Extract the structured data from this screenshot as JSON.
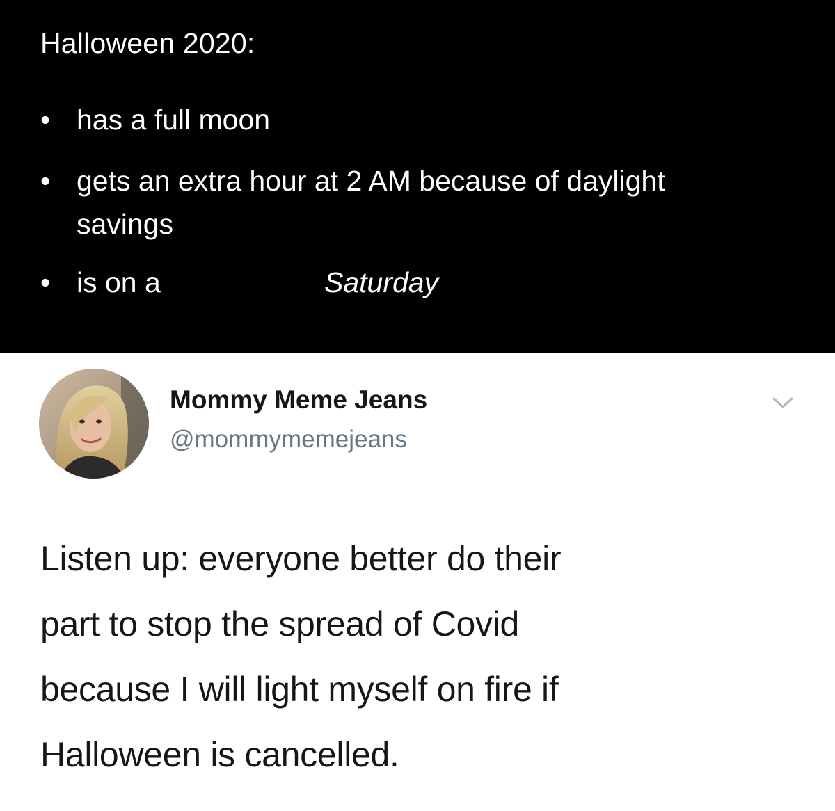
{
  "top_panel": {
    "title": "Halloween 2020:",
    "bullet_symbol": "•",
    "bullets": [
      {
        "text": "has a full moon"
      },
      {
        "text": "gets an extra hour at 2 AM because of daylight",
        "continuation": "savings"
      },
      {
        "text": "is on a",
        "emphasis": "Saturday"
      }
    ],
    "background_color": "#000000",
    "text_color": "#ffffff"
  },
  "tweet": {
    "display_name": "Mommy Meme Jeans",
    "handle": "@mommymemejeans",
    "avatar_icon": "profile-photo-icon",
    "menu_icon": "chevron-down-icon",
    "body_lines": [
      "Listen up: everyone better do their",
      "part to stop the spread of Covid",
      "because I will light myself on fire if",
      "Halloween is cancelled."
    ],
    "name_color": "#14171a",
    "handle_color": "#657786"
  }
}
